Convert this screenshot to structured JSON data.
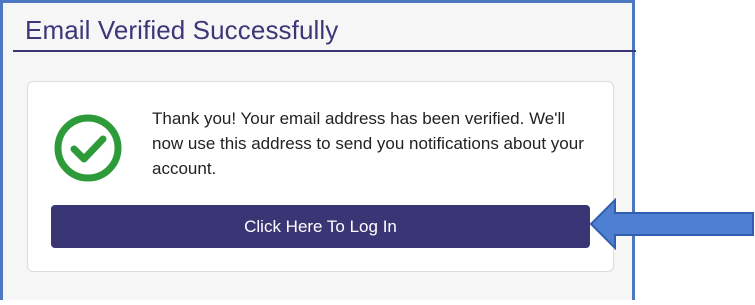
{
  "panel": {
    "title": "Email Verified Successfully"
  },
  "card": {
    "message": "Thank you! Your email address has been verified. We'll now use this address to send you notifications about your account.",
    "button_label": "Click Here To Log In"
  },
  "icons": {
    "status": "check-circle-icon",
    "annotation": "left-arrow-icon"
  },
  "colors": {
    "accent": "#3a3676",
    "success": "#2e9b3a",
    "frame_border": "#4d78c1",
    "annotation_arrow": "#4f7fd0"
  }
}
